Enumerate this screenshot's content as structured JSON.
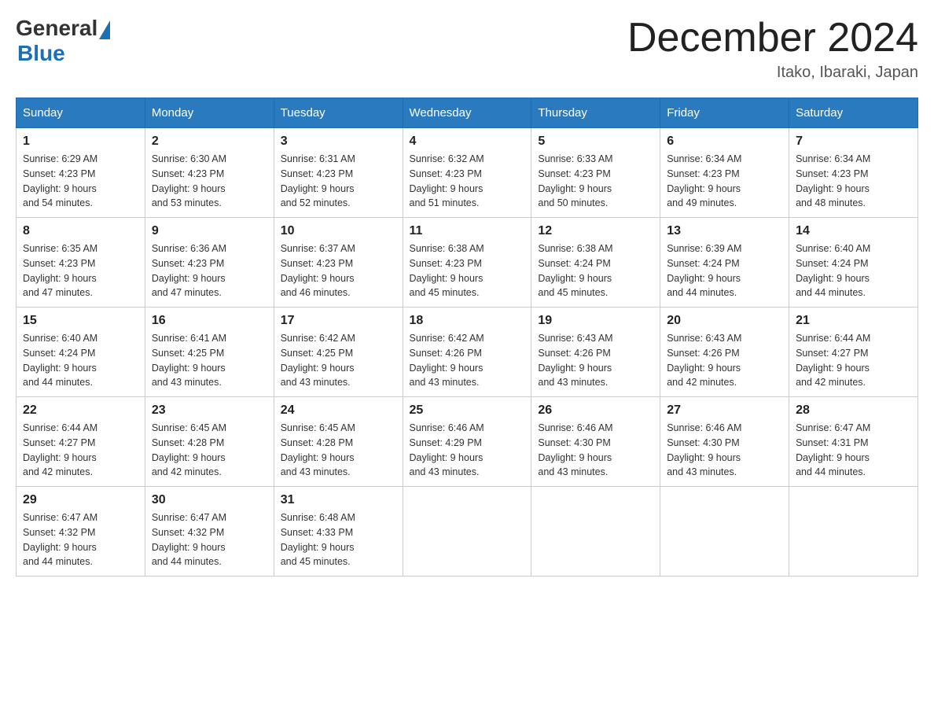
{
  "logo": {
    "general": "General",
    "blue": "Blue",
    "subtitle": ""
  },
  "title": "December 2024",
  "location": "Itako, Ibaraki, Japan",
  "days_of_week": [
    "Sunday",
    "Monday",
    "Tuesday",
    "Wednesday",
    "Thursday",
    "Friday",
    "Saturday"
  ],
  "weeks": [
    [
      {
        "day": "1",
        "sunrise": "6:29 AM",
        "sunset": "4:23 PM",
        "daylight": "9 hours and 54 minutes."
      },
      {
        "day": "2",
        "sunrise": "6:30 AM",
        "sunset": "4:23 PM",
        "daylight": "9 hours and 53 minutes."
      },
      {
        "day": "3",
        "sunrise": "6:31 AM",
        "sunset": "4:23 PM",
        "daylight": "9 hours and 52 minutes."
      },
      {
        "day": "4",
        "sunrise": "6:32 AM",
        "sunset": "4:23 PM",
        "daylight": "9 hours and 51 minutes."
      },
      {
        "day": "5",
        "sunrise": "6:33 AM",
        "sunset": "4:23 PM",
        "daylight": "9 hours and 50 minutes."
      },
      {
        "day": "6",
        "sunrise": "6:34 AM",
        "sunset": "4:23 PM",
        "daylight": "9 hours and 49 minutes."
      },
      {
        "day": "7",
        "sunrise": "6:34 AM",
        "sunset": "4:23 PM",
        "daylight": "9 hours and 48 minutes."
      }
    ],
    [
      {
        "day": "8",
        "sunrise": "6:35 AM",
        "sunset": "4:23 PM",
        "daylight": "9 hours and 47 minutes."
      },
      {
        "day": "9",
        "sunrise": "6:36 AM",
        "sunset": "4:23 PM",
        "daylight": "9 hours and 47 minutes."
      },
      {
        "day": "10",
        "sunrise": "6:37 AM",
        "sunset": "4:23 PM",
        "daylight": "9 hours and 46 minutes."
      },
      {
        "day": "11",
        "sunrise": "6:38 AM",
        "sunset": "4:23 PM",
        "daylight": "9 hours and 45 minutes."
      },
      {
        "day": "12",
        "sunrise": "6:38 AM",
        "sunset": "4:24 PM",
        "daylight": "9 hours and 45 minutes."
      },
      {
        "day": "13",
        "sunrise": "6:39 AM",
        "sunset": "4:24 PM",
        "daylight": "9 hours and 44 minutes."
      },
      {
        "day": "14",
        "sunrise": "6:40 AM",
        "sunset": "4:24 PM",
        "daylight": "9 hours and 44 minutes."
      }
    ],
    [
      {
        "day": "15",
        "sunrise": "6:40 AM",
        "sunset": "4:24 PM",
        "daylight": "9 hours and 44 minutes."
      },
      {
        "day": "16",
        "sunrise": "6:41 AM",
        "sunset": "4:25 PM",
        "daylight": "9 hours and 43 minutes."
      },
      {
        "day": "17",
        "sunrise": "6:42 AM",
        "sunset": "4:25 PM",
        "daylight": "9 hours and 43 minutes."
      },
      {
        "day": "18",
        "sunrise": "6:42 AM",
        "sunset": "4:26 PM",
        "daylight": "9 hours and 43 minutes."
      },
      {
        "day": "19",
        "sunrise": "6:43 AM",
        "sunset": "4:26 PM",
        "daylight": "9 hours and 43 minutes."
      },
      {
        "day": "20",
        "sunrise": "6:43 AM",
        "sunset": "4:26 PM",
        "daylight": "9 hours and 42 minutes."
      },
      {
        "day": "21",
        "sunrise": "6:44 AM",
        "sunset": "4:27 PM",
        "daylight": "9 hours and 42 minutes."
      }
    ],
    [
      {
        "day": "22",
        "sunrise": "6:44 AM",
        "sunset": "4:27 PM",
        "daylight": "9 hours and 42 minutes."
      },
      {
        "day": "23",
        "sunrise": "6:45 AM",
        "sunset": "4:28 PM",
        "daylight": "9 hours and 42 minutes."
      },
      {
        "day": "24",
        "sunrise": "6:45 AM",
        "sunset": "4:28 PM",
        "daylight": "9 hours and 43 minutes."
      },
      {
        "day": "25",
        "sunrise": "6:46 AM",
        "sunset": "4:29 PM",
        "daylight": "9 hours and 43 minutes."
      },
      {
        "day": "26",
        "sunrise": "6:46 AM",
        "sunset": "4:30 PM",
        "daylight": "9 hours and 43 minutes."
      },
      {
        "day": "27",
        "sunrise": "6:46 AM",
        "sunset": "4:30 PM",
        "daylight": "9 hours and 43 minutes."
      },
      {
        "day": "28",
        "sunrise": "6:47 AM",
        "sunset": "4:31 PM",
        "daylight": "9 hours and 44 minutes."
      }
    ],
    [
      {
        "day": "29",
        "sunrise": "6:47 AM",
        "sunset": "4:32 PM",
        "daylight": "9 hours and 44 minutes."
      },
      {
        "day": "30",
        "sunrise": "6:47 AM",
        "sunset": "4:32 PM",
        "daylight": "9 hours and 44 minutes."
      },
      {
        "day": "31",
        "sunrise": "6:48 AM",
        "sunset": "4:33 PM",
        "daylight": "9 hours and 45 minutes."
      },
      null,
      null,
      null,
      null
    ]
  ],
  "labels": {
    "sunrise": "Sunrise:",
    "sunset": "Sunset:",
    "daylight": "Daylight:"
  }
}
